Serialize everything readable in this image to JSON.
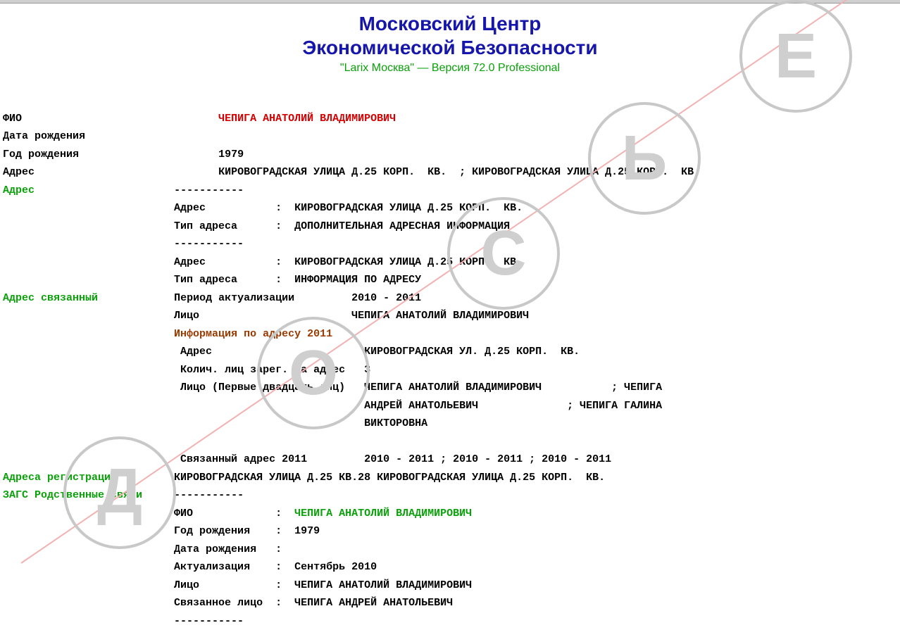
{
  "header": {
    "line1": "Московский Центр",
    "line2": "Экономической Безопасности",
    "version": "\"Larix Москва\" — Версия 72.0 Professional"
  },
  "labels": {
    "fio": "ФИО",
    "dob": "Дата рождения",
    "yob": "Год рождения",
    "addr": "Адрес",
    "addr_link": "Адрес",
    "dashes": "-----------",
    "type_addr": "Тип адреса",
    "related_addr": "Адрес связанный",
    "period": "Период актуализации",
    "person": "Лицо",
    "info_by_addr": "Информация по адресу 2011",
    "regcount": "Колич. лиц зарег. на адрес",
    "pers20": "Лицо (Первые двадцать лиц)",
    "linked_addr_2011": "Связанный адрес 2011",
    "reg_addresses": "Адреса регистрации",
    "zags": "ЗАГС Родственные связи",
    "yob2": "Год рождения",
    "dob2": "Дата рождения",
    "actual": "Актуализация",
    "related_person": "Связанное лицо"
  },
  "values": {
    "fio": "ЧЕПИГА АНАТОЛИЙ ВЛАДИМИРОВИЧ",
    "dob": "",
    "yob": "1979",
    "addr_inline": "КИРОВОГРАДСКАЯ УЛИЦА Д.25 КОРП.  КВ.  ; КИРОВОГРАДСКАЯ УЛИЦА Д.25 КОРП.  КВ.",
    "addr_block1_addr": "КИРОВОГРАДСКАЯ УЛИЦА Д.25 КОРП.  КВ.",
    "addr_block1_type": "ДОПОЛНИТЕЛЬНАЯ АДРЕСНАЯ ИНФОРМАЦИЯ",
    "addr_block2_addr": "КИРОВОГРАДСКАЯ УЛИЦА Д.25 КОРП.  КВ.",
    "addr_block2_type": "ИНФОРМАЦИЯ ПО АДРЕСУ",
    "period": "2010 - 2011",
    "person": "ЧЕПИГА АНАТОЛИЙ ВЛАДИМИРОВИЧ",
    "info_addr": "КИРОВОГРАДСКАЯ УЛ. Д.25 КОРП.  КВ.",
    "regcount": "3",
    "pers20_l1": "ЧЕПИГА АНАТОЛИЙ ВЛАДИМИРОВИЧ           ; ЧЕПИГА",
    "pers20_l2": "АНДРЕЙ АНАТОЛЬЕВИЧ              ; ЧЕПИГА ГАЛИНА",
    "pers20_l3": "ВИКТОРОВНА",
    "linked_addr_2011": "2010 - 2011 ; 2010 - 2011 ; 2010 - 2011",
    "reg_addresses": "КИРОВОГРАДСКАЯ УЛИЦА Д.25 КВ.28 КИРОВОГРАДСКАЯ УЛИЦА Д.25 КОРП.  КВ.",
    "zags_fio": "ЧЕПИГА АНАТОЛИЙ ВЛАДИМИРОВИЧ",
    "zags_yob": "1979",
    "zags_dob": "",
    "zags_actual": "Сентябрь 2010",
    "zags_person": "ЧЕПИГА АНАТОЛИЙ ВЛАДИМИРОВИЧ",
    "zags_related": "ЧЕПИГА АНДРЕЙ АНАТОЛЬЕВИЧ"
  },
  "watermark": "ДОСЬЕ"
}
